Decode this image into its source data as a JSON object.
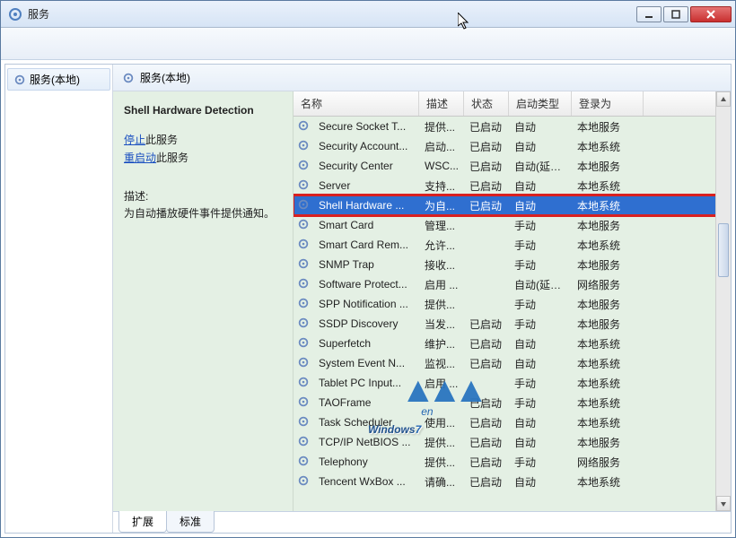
{
  "window": {
    "title": "服务"
  },
  "tree": {
    "root_label": "服务(本地)"
  },
  "pane_header": "服务(本地)",
  "detail": {
    "service_name": "Shell Hardware Detection",
    "stop_link": "停止",
    "stop_suffix": "此服务",
    "restart_link": "重启动",
    "restart_suffix": "此服务",
    "desc_label": "描述:",
    "desc_text": "为自动播放硬件事件提供通知。"
  },
  "columns": {
    "name": "名称",
    "desc": "描述",
    "status": "状态",
    "startup": "启动类型",
    "logon": "登录为"
  },
  "selected_index": 4,
  "services": [
    {
      "name": "Secure Socket T...",
      "desc": "提供...",
      "status": "已启动",
      "startup": "自动",
      "logon": "本地服务"
    },
    {
      "name": "Security Account...",
      "desc": "启动...",
      "status": "已启动",
      "startup": "自动",
      "logon": "本地系统"
    },
    {
      "name": "Security Center",
      "desc": "WSC...",
      "status": "已启动",
      "startup": "自动(延迟...",
      "logon": "本地服务"
    },
    {
      "name": "Server",
      "desc": "支持...",
      "status": "已启动",
      "startup": "自动",
      "logon": "本地系统"
    },
    {
      "name": "Shell Hardware ...",
      "desc": "为自...",
      "status": "已启动",
      "startup": "自动",
      "logon": "本地系统"
    },
    {
      "name": "Smart Card",
      "desc": "管理...",
      "status": "",
      "startup": "手动",
      "logon": "本地服务"
    },
    {
      "name": "Smart Card Rem...",
      "desc": "允许...",
      "status": "",
      "startup": "手动",
      "logon": "本地系统"
    },
    {
      "name": "SNMP Trap",
      "desc": "接收...",
      "status": "",
      "startup": "手动",
      "logon": "本地服务"
    },
    {
      "name": "Software Protect...",
      "desc": "启用 ...",
      "status": "",
      "startup": "自动(延迟...",
      "logon": "网络服务"
    },
    {
      "name": "SPP Notification ...",
      "desc": "提供...",
      "status": "",
      "startup": "手动",
      "logon": "本地服务"
    },
    {
      "name": "SSDP Discovery",
      "desc": "当发...",
      "status": "已启动",
      "startup": "手动",
      "logon": "本地服务"
    },
    {
      "name": "Superfetch",
      "desc": "维护...",
      "status": "已启动",
      "startup": "自动",
      "logon": "本地系统"
    },
    {
      "name": "System Event N...",
      "desc": "监视...",
      "status": "已启动",
      "startup": "自动",
      "logon": "本地系统"
    },
    {
      "name": "Tablet PC Input...",
      "desc": "启用 ...",
      "status": "",
      "startup": "手动",
      "logon": "本地系统"
    },
    {
      "name": "TAOFrame",
      "desc": "",
      "status": "已启动",
      "startup": "手动",
      "logon": "本地系统"
    },
    {
      "name": "Task Scheduler",
      "desc": "使用...",
      "status": "已启动",
      "startup": "自动",
      "logon": "本地系统"
    },
    {
      "name": "TCP/IP NetBIOS ...",
      "desc": "提供...",
      "status": "已启动",
      "startup": "自动",
      "logon": "本地服务"
    },
    {
      "name": "Telephony",
      "desc": "提供...",
      "status": "已启动",
      "startup": "手动",
      "logon": "网络服务"
    },
    {
      "name": "Tencent WxBox ...",
      "desc": "请确...",
      "status": "已启动",
      "startup": "自动",
      "logon": "本地系统"
    }
  ],
  "tabs": {
    "extended": "扩展",
    "standard": "标准"
  },
  "watermark": {
    "text_a": "Windows",
    "text_b": "7",
    "suffix": "en"
  }
}
